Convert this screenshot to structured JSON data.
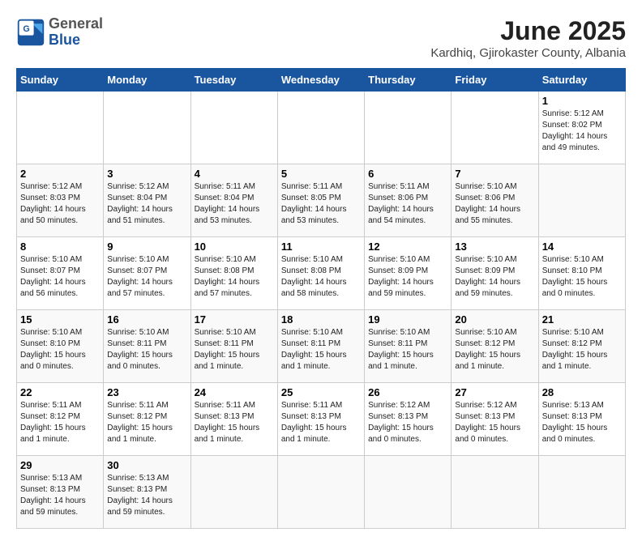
{
  "header": {
    "logo_general": "General",
    "logo_blue": "Blue",
    "month_title": "June 2025",
    "location": "Kardhiq, Gjirokaster County, Albania"
  },
  "calendar": {
    "days_of_week": [
      "Sunday",
      "Monday",
      "Tuesday",
      "Wednesday",
      "Thursday",
      "Friday",
      "Saturday"
    ],
    "weeks": [
      [
        {
          "day": null,
          "info": ""
        },
        {
          "day": null,
          "info": ""
        },
        {
          "day": null,
          "info": ""
        },
        {
          "day": null,
          "info": ""
        },
        {
          "day": null,
          "info": ""
        },
        {
          "day": null,
          "info": ""
        },
        {
          "day": "1",
          "info": "Sunrise: 5:12 AM\nSunset: 8:02 PM\nDaylight: 14 hours\nand 49 minutes."
        }
      ],
      [
        {
          "day": "2",
          "info": "Sunrise: 5:12 AM\nSunset: 8:03 PM\nDaylight: 14 hours\nand 50 minutes."
        },
        {
          "day": "3",
          "info": "Sunrise: 5:12 AM\nSunset: 8:04 PM\nDaylight: 14 hours\nand 51 minutes."
        },
        {
          "day": "4",
          "info": "Sunrise: 5:11 AM\nSunset: 8:04 PM\nDaylight: 14 hours\nand 53 minutes."
        },
        {
          "day": "5",
          "info": "Sunrise: 5:11 AM\nSunset: 8:05 PM\nDaylight: 14 hours\nand 53 minutes."
        },
        {
          "day": "6",
          "info": "Sunrise: 5:11 AM\nSunset: 8:06 PM\nDaylight: 14 hours\nand 54 minutes."
        },
        {
          "day": "7",
          "info": "Sunrise: 5:10 AM\nSunset: 8:06 PM\nDaylight: 14 hours\nand 55 minutes."
        }
      ],
      [
        {
          "day": "8",
          "info": "Sunrise: 5:10 AM\nSunset: 8:07 PM\nDaylight: 14 hours\nand 56 minutes."
        },
        {
          "day": "9",
          "info": "Sunrise: 5:10 AM\nSunset: 8:07 PM\nDaylight: 14 hours\nand 57 minutes."
        },
        {
          "day": "10",
          "info": "Sunrise: 5:10 AM\nSunset: 8:08 PM\nDaylight: 14 hours\nand 57 minutes."
        },
        {
          "day": "11",
          "info": "Sunrise: 5:10 AM\nSunset: 8:08 PM\nDaylight: 14 hours\nand 58 minutes."
        },
        {
          "day": "12",
          "info": "Sunrise: 5:10 AM\nSunset: 8:09 PM\nDaylight: 14 hours\nand 59 minutes."
        },
        {
          "day": "13",
          "info": "Sunrise: 5:10 AM\nSunset: 8:09 PM\nDaylight: 14 hours\nand 59 minutes."
        },
        {
          "day": "14",
          "info": "Sunrise: 5:10 AM\nSunset: 8:10 PM\nDaylight: 15 hours\nand 0 minutes."
        }
      ],
      [
        {
          "day": "15",
          "info": "Sunrise: 5:10 AM\nSunset: 8:10 PM\nDaylight: 15 hours\nand 0 minutes."
        },
        {
          "day": "16",
          "info": "Sunrise: 5:10 AM\nSunset: 8:11 PM\nDaylight: 15 hours\nand 0 minutes."
        },
        {
          "day": "17",
          "info": "Sunrise: 5:10 AM\nSunset: 8:11 PM\nDaylight: 15 hours\nand 1 minute."
        },
        {
          "day": "18",
          "info": "Sunrise: 5:10 AM\nSunset: 8:11 PM\nDaylight: 15 hours\nand 1 minute."
        },
        {
          "day": "19",
          "info": "Sunrise: 5:10 AM\nSunset: 8:11 PM\nDaylight: 15 hours\nand 1 minute."
        },
        {
          "day": "20",
          "info": "Sunrise: 5:10 AM\nSunset: 8:12 PM\nDaylight: 15 hours\nand 1 minute."
        },
        {
          "day": "21",
          "info": "Sunrise: 5:10 AM\nSunset: 8:12 PM\nDaylight: 15 hours\nand 1 minute."
        }
      ],
      [
        {
          "day": "22",
          "info": "Sunrise: 5:11 AM\nSunset: 8:12 PM\nDaylight: 15 hours\nand 1 minute."
        },
        {
          "day": "23",
          "info": "Sunrise: 5:11 AM\nSunset: 8:12 PM\nDaylight: 15 hours\nand 1 minute."
        },
        {
          "day": "24",
          "info": "Sunrise: 5:11 AM\nSunset: 8:13 PM\nDaylight: 15 hours\nand 1 minute."
        },
        {
          "day": "25",
          "info": "Sunrise: 5:11 AM\nSunset: 8:13 PM\nDaylight: 15 hours\nand 1 minute."
        },
        {
          "day": "26",
          "info": "Sunrise: 5:12 AM\nSunset: 8:13 PM\nDaylight: 15 hours\nand 0 minutes."
        },
        {
          "day": "27",
          "info": "Sunrise: 5:12 AM\nSunset: 8:13 PM\nDaylight: 15 hours\nand 0 minutes."
        },
        {
          "day": "28",
          "info": "Sunrise: 5:13 AM\nSunset: 8:13 PM\nDaylight: 15 hours\nand 0 minutes."
        }
      ],
      [
        {
          "day": "29",
          "info": "Sunrise: 5:13 AM\nSunset: 8:13 PM\nDaylight: 14 hours\nand 59 minutes."
        },
        {
          "day": "30",
          "info": "Sunrise: 5:13 AM\nSunset: 8:13 PM\nDaylight: 14 hours\nand 59 minutes."
        },
        {
          "day": null,
          "info": ""
        },
        {
          "day": null,
          "info": ""
        },
        {
          "day": null,
          "info": ""
        },
        {
          "day": null,
          "info": ""
        },
        {
          "day": null,
          "info": ""
        }
      ]
    ]
  }
}
